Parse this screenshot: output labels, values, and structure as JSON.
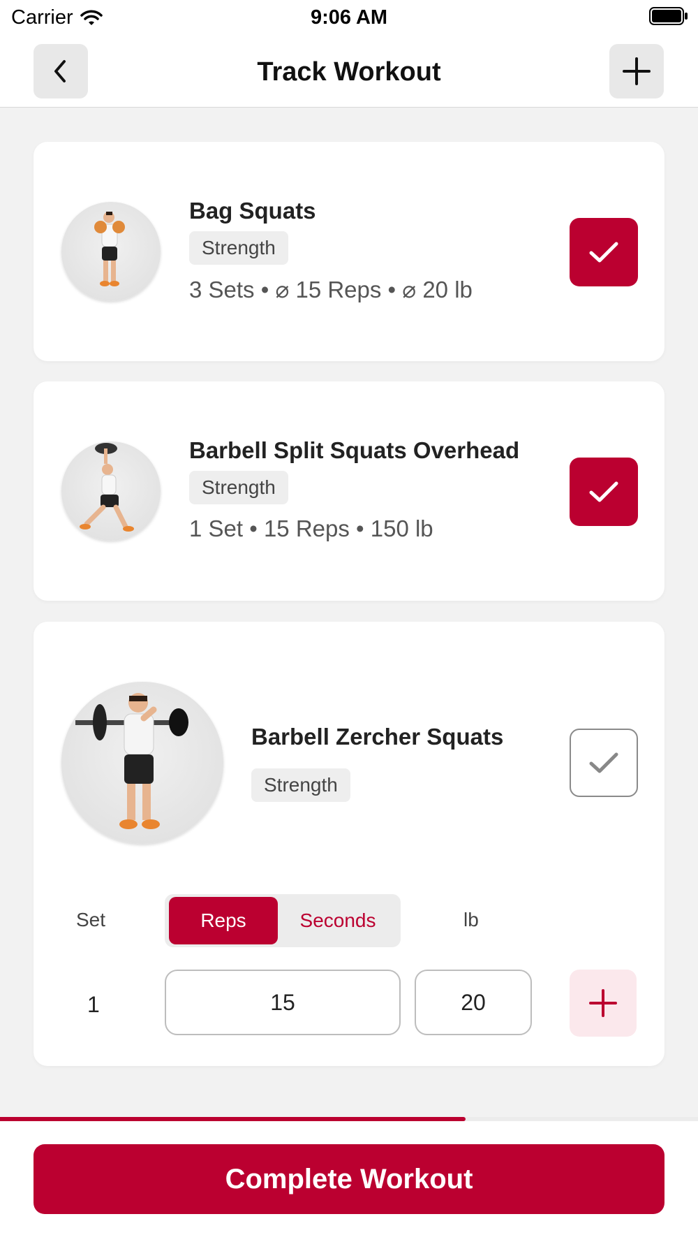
{
  "status_bar": {
    "carrier": "Carrier",
    "time": "9:06 AM"
  },
  "nav": {
    "title": "Track Workout",
    "back_icon": "chevron-left-icon",
    "add_icon": "plus-icon"
  },
  "exercises": [
    {
      "title": "Bag Squats",
      "tag": "Strength",
      "summary": "3 Sets • ⌀ 15 Reps • ⌀ 20 lb",
      "completed": true
    },
    {
      "title": "Barbell Split Squats Overhead",
      "tag": "Strength",
      "summary": "1 Set • 15 Reps • 150 lb",
      "completed": true
    },
    {
      "title": "Barbell Zercher Squats",
      "tag": "Strength",
      "completed": false,
      "table": {
        "set_header": "Set",
        "modes": [
          "Reps",
          "Seconds"
        ],
        "selected_mode": "Reps",
        "unit_header": "lb",
        "rows": [
          {
            "set": "1",
            "reps": "15",
            "weight": "20"
          }
        ]
      }
    }
  ],
  "progress": {
    "fraction": 0.667
  },
  "complete_button": "Complete Workout",
  "colors": {
    "accent": "#bb0030",
    "background": "#f2f2f2"
  }
}
